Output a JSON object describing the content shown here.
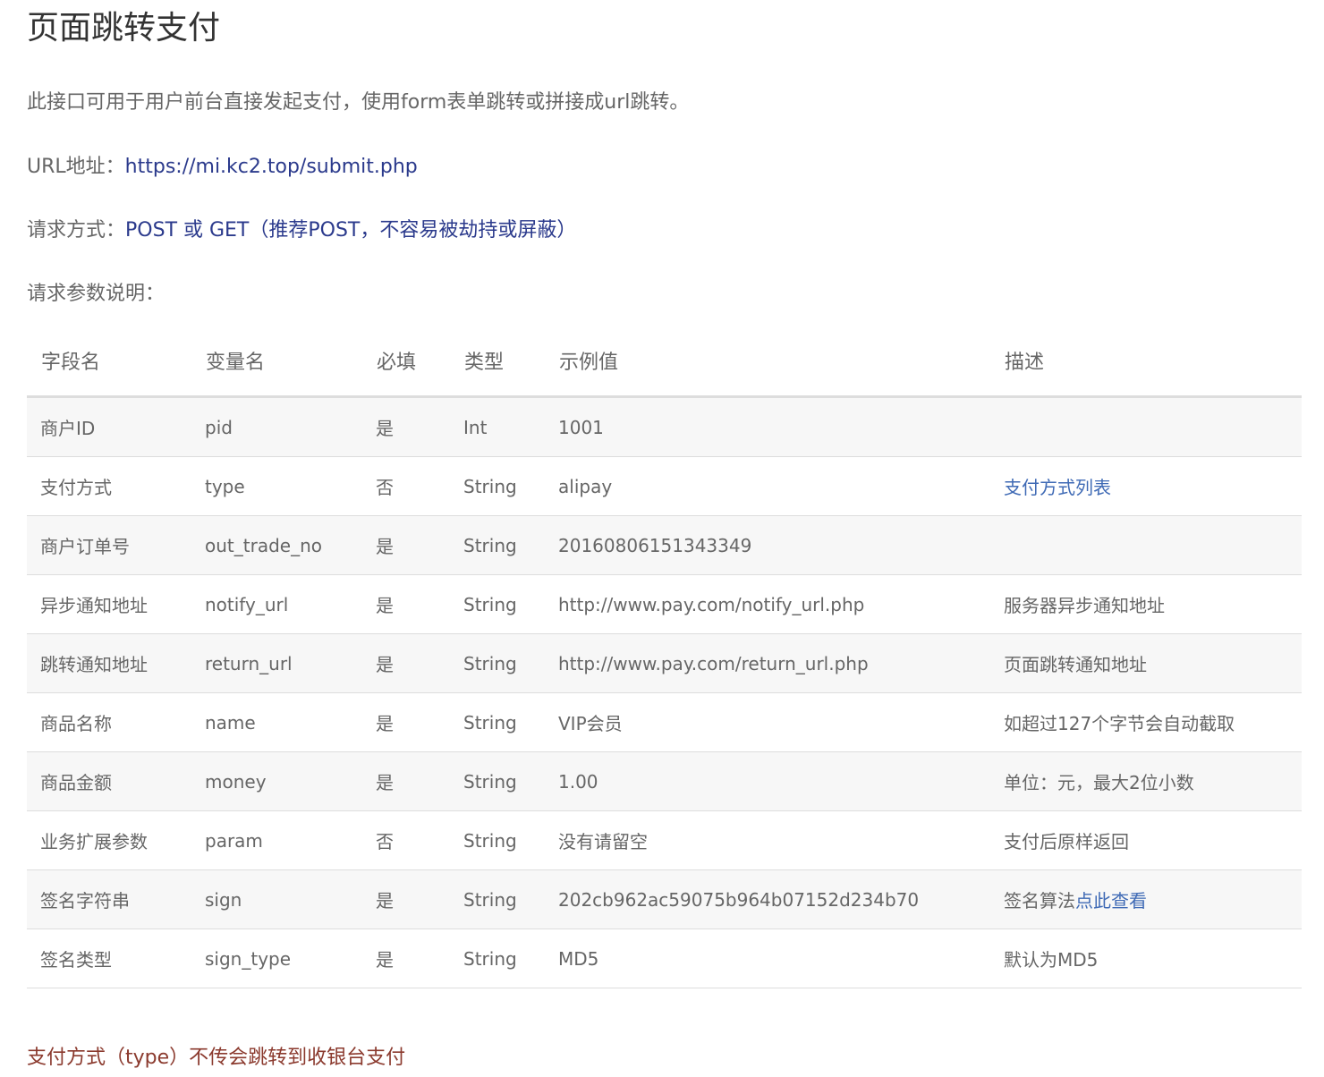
{
  "title": "页面跳转支付",
  "intro": "此接口可用于用户前台直接发起支付，使用form表单跳转或拼接成url跳转。",
  "url": {
    "label": "URL地址：",
    "value": "https://mi.kc2.top/submit.php"
  },
  "method": {
    "label": "请求方式：",
    "value": "POST 或 GET（推荐POST，不容易被劫持或屏蔽）"
  },
  "params_heading": "请求参数说明：",
  "table": {
    "headers": [
      "字段名",
      "变量名",
      "必填",
      "类型",
      "示例值",
      "描述"
    ],
    "rows": [
      {
        "field": "商户ID",
        "var": "pid",
        "required": "是",
        "type": "Int",
        "example": "1001",
        "desc": "",
        "desc_link": ""
      },
      {
        "field": "支付方式",
        "var": "type",
        "required": "否",
        "type": "String",
        "example": "alipay",
        "desc": "",
        "desc_link": "支付方式列表"
      },
      {
        "field": "商户订单号",
        "var": "out_trade_no",
        "required": "是",
        "type": "String",
        "example": "20160806151343349",
        "desc": "",
        "desc_link": ""
      },
      {
        "field": "异步通知地址",
        "var": "notify_url",
        "required": "是",
        "type": "String",
        "example": "http://www.pay.com/notify_url.php",
        "desc": "服务器异步通知地址",
        "desc_link": ""
      },
      {
        "field": "跳转通知地址",
        "var": "return_url",
        "required": "是",
        "type": "String",
        "example": "http://www.pay.com/return_url.php",
        "desc": "页面跳转通知地址",
        "desc_link": ""
      },
      {
        "field": "商品名称",
        "var": "name",
        "required": "是",
        "type": "String",
        "example": "VIP会员",
        "desc": "如超过127个字节会自动截取",
        "desc_link": ""
      },
      {
        "field": "商品金额",
        "var": "money",
        "required": "是",
        "type": "String",
        "example": "1.00",
        "desc": "单位：元，最大2位小数",
        "desc_link": ""
      },
      {
        "field": "业务扩展参数",
        "var": "param",
        "required": "否",
        "type": "String",
        "example": "没有请留空",
        "desc": "支付后原样返回",
        "desc_link": ""
      },
      {
        "field": "签名字符串",
        "var": "sign",
        "required": "是",
        "type": "String",
        "example": "202cb962ac59075b964b07152d234b70",
        "desc": "签名算法",
        "desc_link": "点此查看"
      },
      {
        "field": "签名类型",
        "var": "sign_type",
        "required": "是",
        "type": "String",
        "example": "MD5",
        "desc": "默认为MD5",
        "desc_link": ""
      }
    ]
  },
  "note": "支付方式（type）不传会跳转到收银台支付",
  "colors": {
    "text": "#666666",
    "link": "#3f6ab5",
    "code_blue": "#2b3a8c",
    "note_red": "#8b3a2e",
    "stripe": "#f7f7f7",
    "border": "#dddddd"
  }
}
